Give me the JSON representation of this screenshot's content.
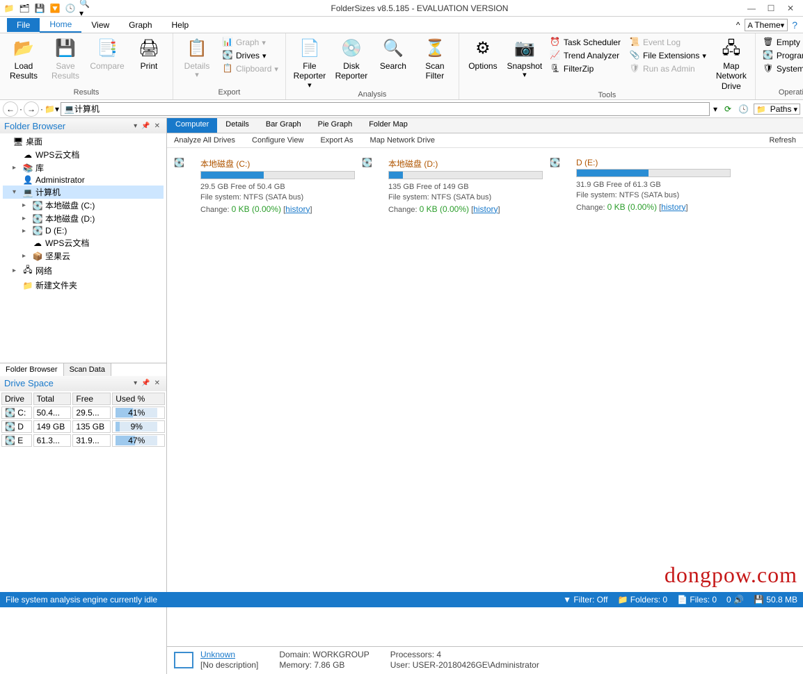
{
  "title": "FolderSizes v8.5.185 - EVALUATION VERSION",
  "menus": {
    "file": "File",
    "home": "Home",
    "view": "View",
    "graph": "Graph",
    "help": "Help"
  },
  "theme_label": "Theme",
  "ribbon": {
    "results": {
      "label": "Results",
      "load": "Load\nResults",
      "save": "Save\nResults",
      "compare": "Compare",
      "print": "Print"
    },
    "export": {
      "label": "Export",
      "details": "Details",
      "graph": "Graph",
      "drives": "Drives",
      "clipboard": "Clipboard"
    },
    "analysis": {
      "label": "Analysis",
      "file_reporter": "File\nReporter",
      "disk_reporter": "Disk\nReporter",
      "search": "Search",
      "scan_filter": "Scan\nFilter"
    },
    "tools": {
      "label": "Tools",
      "options": "Options",
      "snapshot": "Snapshot",
      "task_scheduler": "Task Scheduler",
      "trend_analyzer": "Trend Analyzer",
      "filterzip": "FilterZip",
      "event_log": "Event Log",
      "file_extensions": "File Extensions",
      "run_as_admin": "Run as Admin",
      "map_network_drive": "Map Network\nDrive"
    },
    "os": {
      "label": "Operating System",
      "empty_recycle": "Empty Recycle Bin",
      "programs_features": "Programs & Features",
      "system_protection": "System Protection"
    }
  },
  "address": "计算机",
  "paths_label": "Paths",
  "panels": {
    "folder_browser": "Folder Browser",
    "drive_space": "Drive Space"
  },
  "tree": {
    "desktop": "桌面",
    "wps": "WPS云文档",
    "libs": "库",
    "admin": "Administrator",
    "computer": "计算机",
    "cdrive": "本地磁盘 (C:)",
    "ddrive": "本地磁盘 (D:)",
    "edrive": "D (E:)",
    "wps2": "WPS云文档",
    "jianguo": "坚果云",
    "network": "网络",
    "newfolder": "新建文件夹"
  },
  "bottom_tabs": {
    "folder_browser": "Folder Browser",
    "scan_data": "Scan Data"
  },
  "drive_table": {
    "headers": {
      "drive": "Drive",
      "total": "Total",
      "free": "Free",
      "used": "Used %"
    },
    "rows": [
      {
        "drive": "C:",
        "total": "50.4...",
        "free": "29.5...",
        "used": "41%",
        "pct": 41
      },
      {
        "drive": "D",
        "total": "149 GB",
        "free": "135 GB",
        "used": "9%",
        "pct": 9
      },
      {
        "drive": "E",
        "total": "61.3...",
        "free": "31.9...",
        "used": "47%",
        "pct": 47
      }
    ]
  },
  "view_tabs": {
    "computer": "Computer",
    "details": "Details",
    "bar": "Bar Graph",
    "pie": "Pie Graph",
    "map": "Folder Map"
  },
  "actions": {
    "analyze": "Analyze All Drives",
    "configure": "Configure View",
    "export": "Export As",
    "map": "Map Network Drive",
    "refresh": "Refresh"
  },
  "drives": [
    {
      "name": "本地磁盘 (C:)",
      "free": "29.5 GB Free of 50.4 GB",
      "fs": "File system: NTFS (SATA bus)",
      "change_label": "Change:",
      "change_val": "0 KB (0.00%)",
      "hist": "history",
      "pct": 41
    },
    {
      "name": "本地磁盘 (D:)",
      "free": "135 GB Free of 149 GB",
      "fs": "File system: NTFS (SATA bus)",
      "change_label": "Change:",
      "change_val": "0 KB (0.00%)",
      "hist": "history",
      "pct": 9
    },
    {
      "name": "D (E:)",
      "free": "31.9 GB Free of 61.3 GB",
      "fs": "File system: NTFS (SATA bus)",
      "change_label": "Change:",
      "change_val": "0 KB (0.00%)",
      "hist": "history",
      "pct": 47
    }
  ],
  "info": {
    "unknown": "Unknown",
    "nodesc": "[No description]",
    "domain": "Domain: WORKGROUP",
    "memory": "Memory: 7.86 GB",
    "processors": "Processors: 4",
    "user": "User: USER-20180426GE\\Administrator"
  },
  "status": {
    "left": "File system analysis engine currently idle",
    "filter": "Filter: Off",
    "folders": "Folders: 0",
    "files": "Files: 0",
    "zero2": "0",
    "size": "50.8 MB"
  },
  "watermark": "dongpow.com"
}
